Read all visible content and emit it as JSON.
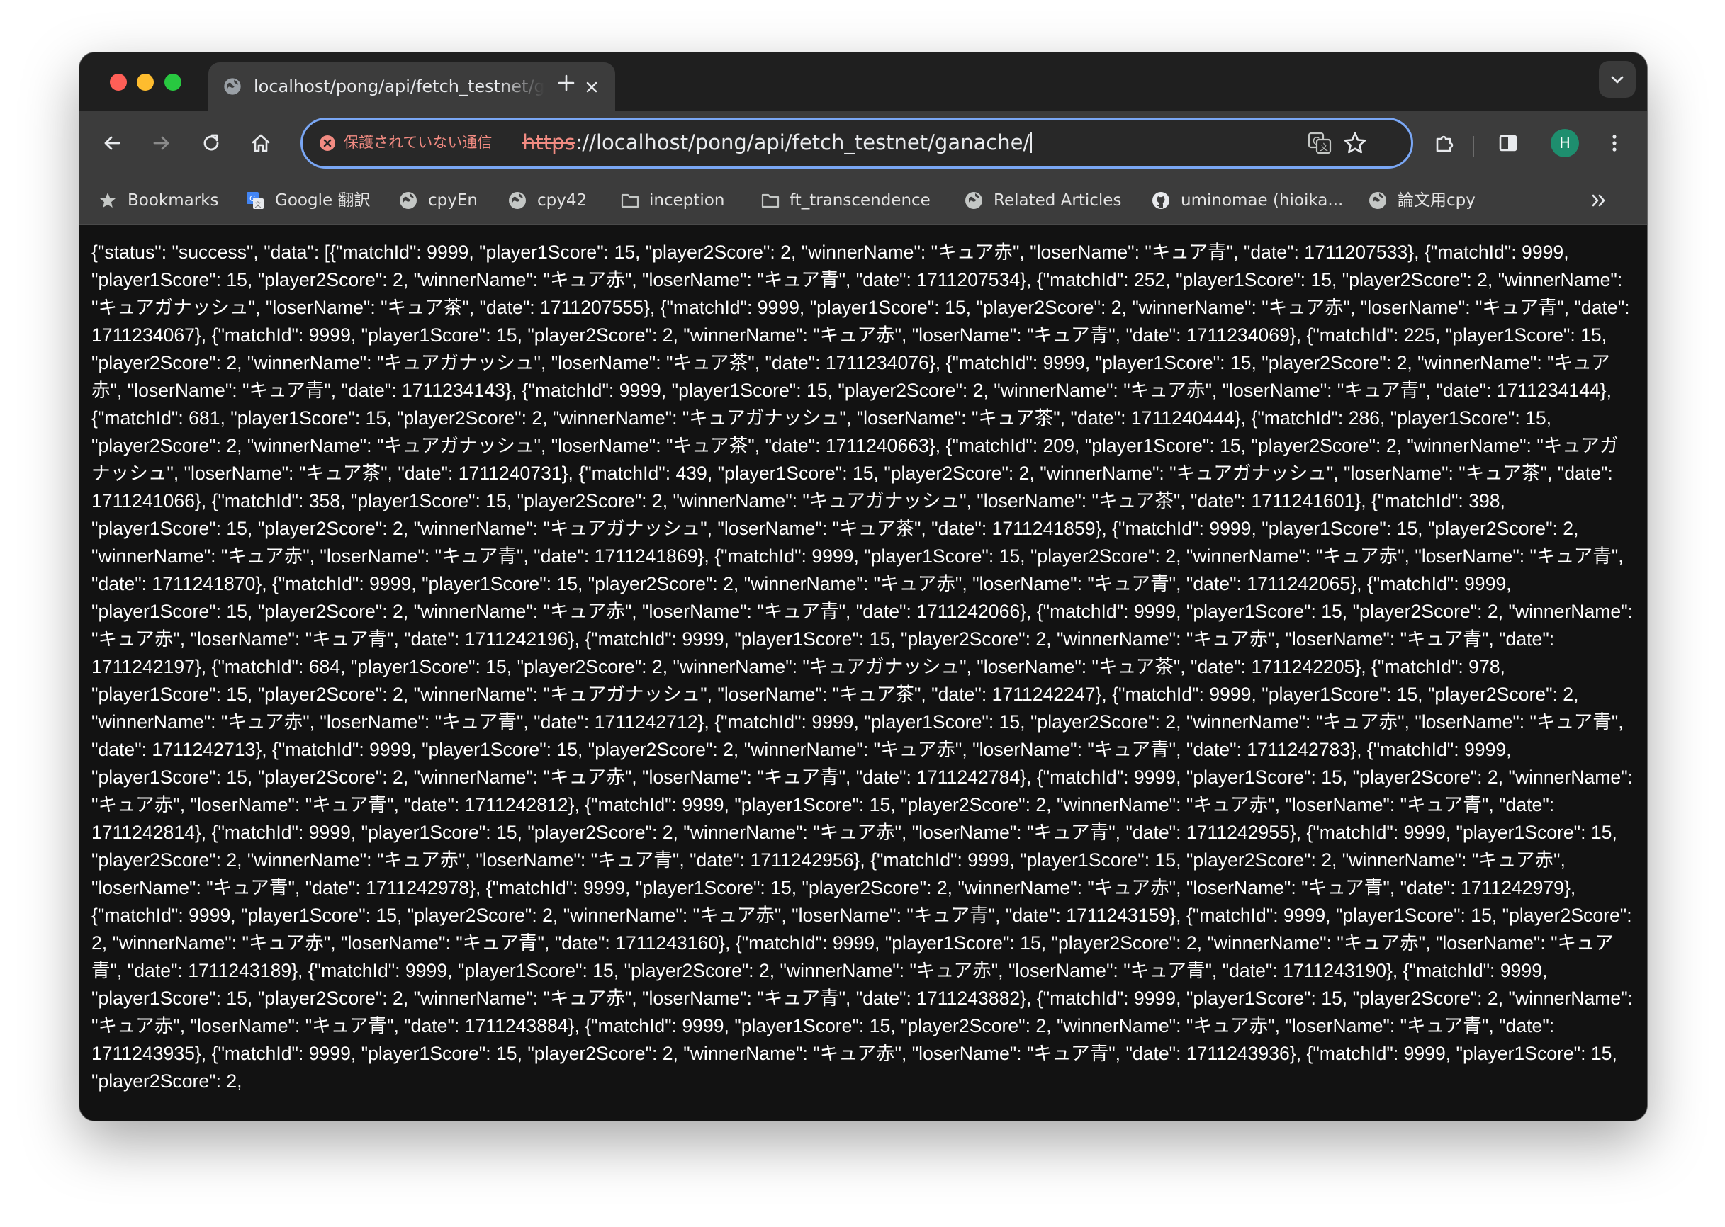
{
  "tab": {
    "title": "localhost/pong/api/fetch_testnet/ganache/",
    "favicon": "globe-icon"
  },
  "omnibox": {
    "security_label": "保護されていない通信",
    "url_scheme": "https",
    "url_rest": "://localhost/pong/api/fetch_testnet/ganache/"
  },
  "profile": {
    "initial": "H",
    "color": "#1e8e6e"
  },
  "bookmarks": [
    {
      "label": "Bookmarks",
      "icon": "star-icon"
    },
    {
      "label": "Google 翻訳",
      "icon": "google-translate-icon"
    },
    {
      "label": "cpyEn",
      "icon": "globe-icon"
    },
    {
      "label": "cpy42",
      "icon": "globe-icon"
    },
    {
      "label": "inception",
      "icon": "folder-icon"
    },
    {
      "label": "ft_transcendence",
      "icon": "folder-icon"
    },
    {
      "label": "Related Articles",
      "icon": "globe-icon"
    },
    {
      "label": "uminomae (hioika...",
      "icon": "github-icon"
    },
    {
      "label": "論文用cpy",
      "icon": "globe-icon"
    }
  ],
  "page": {
    "body": "{\"status\": \"success\", \"data\": [{\"matchId\": 9999, \"player1Score\": 15, \"player2Score\": 2, \"winnerName\": \"キュア赤\", \"loserName\": \"キュア青\", \"date\": 1711207533}, {\"matchId\": 9999, \"player1Score\": 15, \"player2Score\": 2, \"winnerName\": \"キュア赤\", \"loserName\": \"キュア青\", \"date\": 1711207534}, {\"matchId\": 252, \"player1Score\": 15, \"player2Score\": 2, \"winnerName\": \"キュアガナッシュ\", \"loserName\": \"キュア茶\", \"date\": 1711207555}, {\"matchId\": 9999, \"player1Score\": 15, \"player2Score\": 2, \"winnerName\": \"キュア赤\", \"loserName\": \"キュア青\", \"date\": 1711234067}, {\"matchId\": 9999, \"player1Score\": 15, \"player2Score\": 2, \"winnerName\": \"キュア赤\", \"loserName\": \"キュア青\", \"date\": 1711234069}, {\"matchId\": 225, \"player1Score\": 15, \"player2Score\": 2, \"winnerName\": \"キュアガナッシュ\", \"loserName\": \"キュア茶\", \"date\": 1711234076}, {\"matchId\": 9999, \"player1Score\": 15, \"player2Score\": 2, \"winnerName\": \"キュア赤\", \"loserName\": \"キュア青\", \"date\": 1711234143}, {\"matchId\": 9999, \"player1Score\": 15, \"player2Score\": 2, \"winnerName\": \"キュア赤\", \"loserName\": \"キュア青\", \"date\": 1711234144}, {\"matchId\": 681, \"player1Score\": 15, \"player2Score\": 2, \"winnerName\": \"キュアガナッシュ\", \"loserName\": \"キュア茶\", \"date\": 1711240444}, {\"matchId\": 286, \"player1Score\": 15, \"player2Score\": 2, \"winnerName\": \"キュアガナッシュ\", \"loserName\": \"キュア茶\", \"date\": 1711240663}, {\"matchId\": 209, \"player1Score\": 15, \"player2Score\": 2, \"winnerName\": \"キュアガナッシュ\", \"loserName\": \"キュア茶\", \"date\": 1711240731}, {\"matchId\": 439, \"player1Score\": 15, \"player2Score\": 2, \"winnerName\": \"キュアガナッシュ\", \"loserName\": \"キュア茶\", \"date\": 1711241066}, {\"matchId\": 358, \"player1Score\": 15, \"player2Score\": 2, \"winnerName\": \"キュアガナッシュ\", \"loserName\": \"キュア茶\", \"date\": 1711241601}, {\"matchId\": 398, \"player1Score\": 15, \"player2Score\": 2, \"winnerName\": \"キュアガナッシュ\", \"loserName\": \"キュア茶\", \"date\": 1711241859}, {\"matchId\": 9999, \"player1Score\": 15, \"player2Score\": 2, \"winnerName\": \"キュア赤\", \"loserName\": \"キュア青\", \"date\": 1711241869}, {\"matchId\": 9999, \"player1Score\": 15, \"player2Score\": 2, \"winnerName\": \"キュア赤\", \"loserName\": \"キュア青\", \"date\": 1711241870}, {\"matchId\": 9999, \"player1Score\": 15, \"player2Score\": 2, \"winnerName\": \"キュア赤\", \"loserName\": \"キュア青\", \"date\": 1711242065}, {\"matchId\": 9999, \"player1Score\": 15, \"player2Score\": 2, \"winnerName\": \"キュア赤\", \"loserName\": \"キュア青\", \"date\": 1711242066}, {\"matchId\": 9999, \"player1Score\": 15, \"player2Score\": 2, \"winnerName\": \"キュア赤\", \"loserName\": \"キュア青\", \"date\": 1711242196}, {\"matchId\": 9999, \"player1Score\": 15, \"player2Score\": 2, \"winnerName\": \"キュア赤\", \"loserName\": \"キュア青\", \"date\": 1711242197}, {\"matchId\": 684, \"player1Score\": 15, \"player2Score\": 2, \"winnerName\": \"キュアガナッシュ\", \"loserName\": \"キュア茶\", \"date\": 1711242205}, {\"matchId\": 978, \"player1Score\": 15, \"player2Score\": 2, \"winnerName\": \"キュアガナッシュ\", \"loserName\": \"キュア茶\", \"date\": 1711242247}, {\"matchId\": 9999, \"player1Score\": 15, \"player2Score\": 2, \"winnerName\": \"キュア赤\", \"loserName\": \"キュア青\", \"date\": 1711242712}, {\"matchId\": 9999, \"player1Score\": 15, \"player2Score\": 2, \"winnerName\": \"キュア赤\", \"loserName\": \"キュア青\", \"date\": 1711242713}, {\"matchId\": 9999, \"player1Score\": 15, \"player2Score\": 2, \"winnerName\": \"キュア赤\", \"loserName\": \"キュア青\", \"date\": 1711242783}, {\"matchId\": 9999, \"player1Score\": 15, \"player2Score\": 2, \"winnerName\": \"キュア赤\", \"loserName\": \"キュア青\", \"date\": 1711242784}, {\"matchId\": 9999, \"player1Score\": 15, \"player2Score\": 2, \"winnerName\": \"キュア赤\", \"loserName\": \"キュア青\", \"date\": 1711242812}, {\"matchId\": 9999, \"player1Score\": 15, \"player2Score\": 2, \"winnerName\": \"キュア赤\", \"loserName\": \"キュア青\", \"date\": 1711242814}, {\"matchId\": 9999, \"player1Score\": 15, \"player2Score\": 2, \"winnerName\": \"キュア赤\", \"loserName\": \"キュア青\", \"date\": 1711242955}, {\"matchId\": 9999, \"player1Score\": 15, \"player2Score\": 2, \"winnerName\": \"キュア赤\", \"loserName\": \"キュア青\", \"date\": 1711242956}, {\"matchId\": 9999, \"player1Score\": 15, \"player2Score\": 2, \"winnerName\": \"キュア赤\", \"loserName\": \"キュア青\", \"date\": 1711242978}, {\"matchId\": 9999, \"player1Score\": 15, \"player2Score\": 2, \"winnerName\": \"キュア赤\", \"loserName\": \"キュア青\", \"date\": 1711242979}, {\"matchId\": 9999, \"player1Score\": 15, \"player2Score\": 2, \"winnerName\": \"キュア赤\", \"loserName\": \"キュア青\", \"date\": 1711243159}, {\"matchId\": 9999, \"player1Score\": 15, \"player2Score\": 2, \"winnerName\": \"キュア赤\", \"loserName\": \"キュア青\", \"date\": 1711243160}, {\"matchId\": 9999, \"player1Score\": 15, \"player2Score\": 2, \"winnerName\": \"キュア赤\", \"loserName\": \"キュア青\", \"date\": 1711243189}, {\"matchId\": 9999, \"player1Score\": 15, \"player2Score\": 2, \"winnerName\": \"キュア赤\", \"loserName\": \"キュア青\", \"date\": 1711243190}, {\"matchId\": 9999, \"player1Score\": 15, \"player2Score\": 2, \"winnerName\": \"キュア赤\", \"loserName\": \"キュア青\", \"date\": 1711243882}, {\"matchId\": 9999, \"player1Score\": 15, \"player2Score\": 2, \"winnerName\": \"キュア赤\", \"loserName\": \"キュア青\", \"date\": 1711243884}, {\"matchId\": 9999, \"player1Score\": 15, \"player2Score\": 2, \"winnerName\": \"キュア赤\", \"loserName\": \"キュア青\", \"date\": 1711243935}, {\"matchId\": 9999, \"player1Score\": 15, \"player2Score\": 2, \"winnerName\": \"キュア赤\", \"loserName\": \"キュア青\", \"date\": 1711243936}, {\"matchId\": 9999, \"player1Score\": 15, \"player2Score\": 2,"
  }
}
